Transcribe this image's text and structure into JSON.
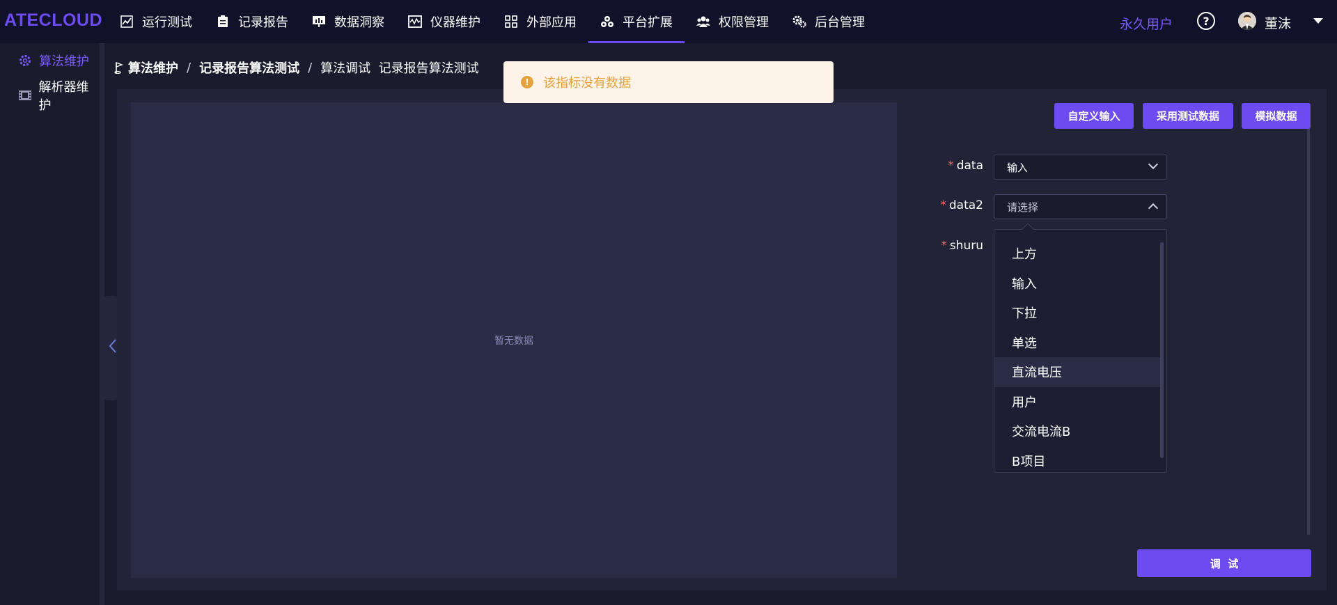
{
  "app": {
    "logo": "ATECLOUD"
  },
  "nav": {
    "items": [
      {
        "label": "运行测试",
        "icon": "trend-chart-icon"
      },
      {
        "label": "记录报告",
        "icon": "clipboard-icon"
      },
      {
        "label": "数据洞察",
        "icon": "presentation-chart-icon"
      },
      {
        "label": "仪器维护",
        "icon": "oscilloscope-icon"
      },
      {
        "label": "外部应用",
        "icon": "grid-apps-icon"
      },
      {
        "label": "平台扩展",
        "icon": "extension-cluster-icon",
        "active": true
      },
      {
        "label": "权限管理",
        "icon": "users-group-icon"
      },
      {
        "label": "后台管理",
        "icon": "gears-icon"
      }
    ],
    "user_type": "永久用户",
    "help": "?",
    "user_name": "董沫"
  },
  "sidebar": {
    "items": [
      {
        "label": "算法维护",
        "icon": "gear-icon",
        "active": true
      },
      {
        "label": "解析器维护",
        "icon": "film-icon"
      }
    ]
  },
  "breadcrumb": {
    "item1": "算法维护",
    "item2": "记录报告算法测试",
    "item3": "算法调试  记录报告算法测试",
    "separator": "/"
  },
  "chart": {
    "empty_text": "暂无数据"
  },
  "toolbar": {
    "custom_input": "自定义输入",
    "use_test_data": "采用测试数据",
    "mock_data": "模拟数据"
  },
  "form": {
    "required_mark": "*",
    "data_label": "data",
    "data_value": "输入",
    "data2_label": "data2",
    "data2_placeholder": "请选择",
    "shuru_label": "shuru"
  },
  "dropdown": {
    "options": [
      "上方",
      "输入",
      "下拉",
      "单选",
      "直流电压",
      "用户",
      "交流电流B",
      "B项目"
    ],
    "hover_index": 4
  },
  "debug_button": "调  试",
  "toast": {
    "message": "该指标没有数据"
  },
  "colors": {
    "accent": "#6c4cf0",
    "warning": "#e6a23c",
    "required": "#f56c6c"
  }
}
